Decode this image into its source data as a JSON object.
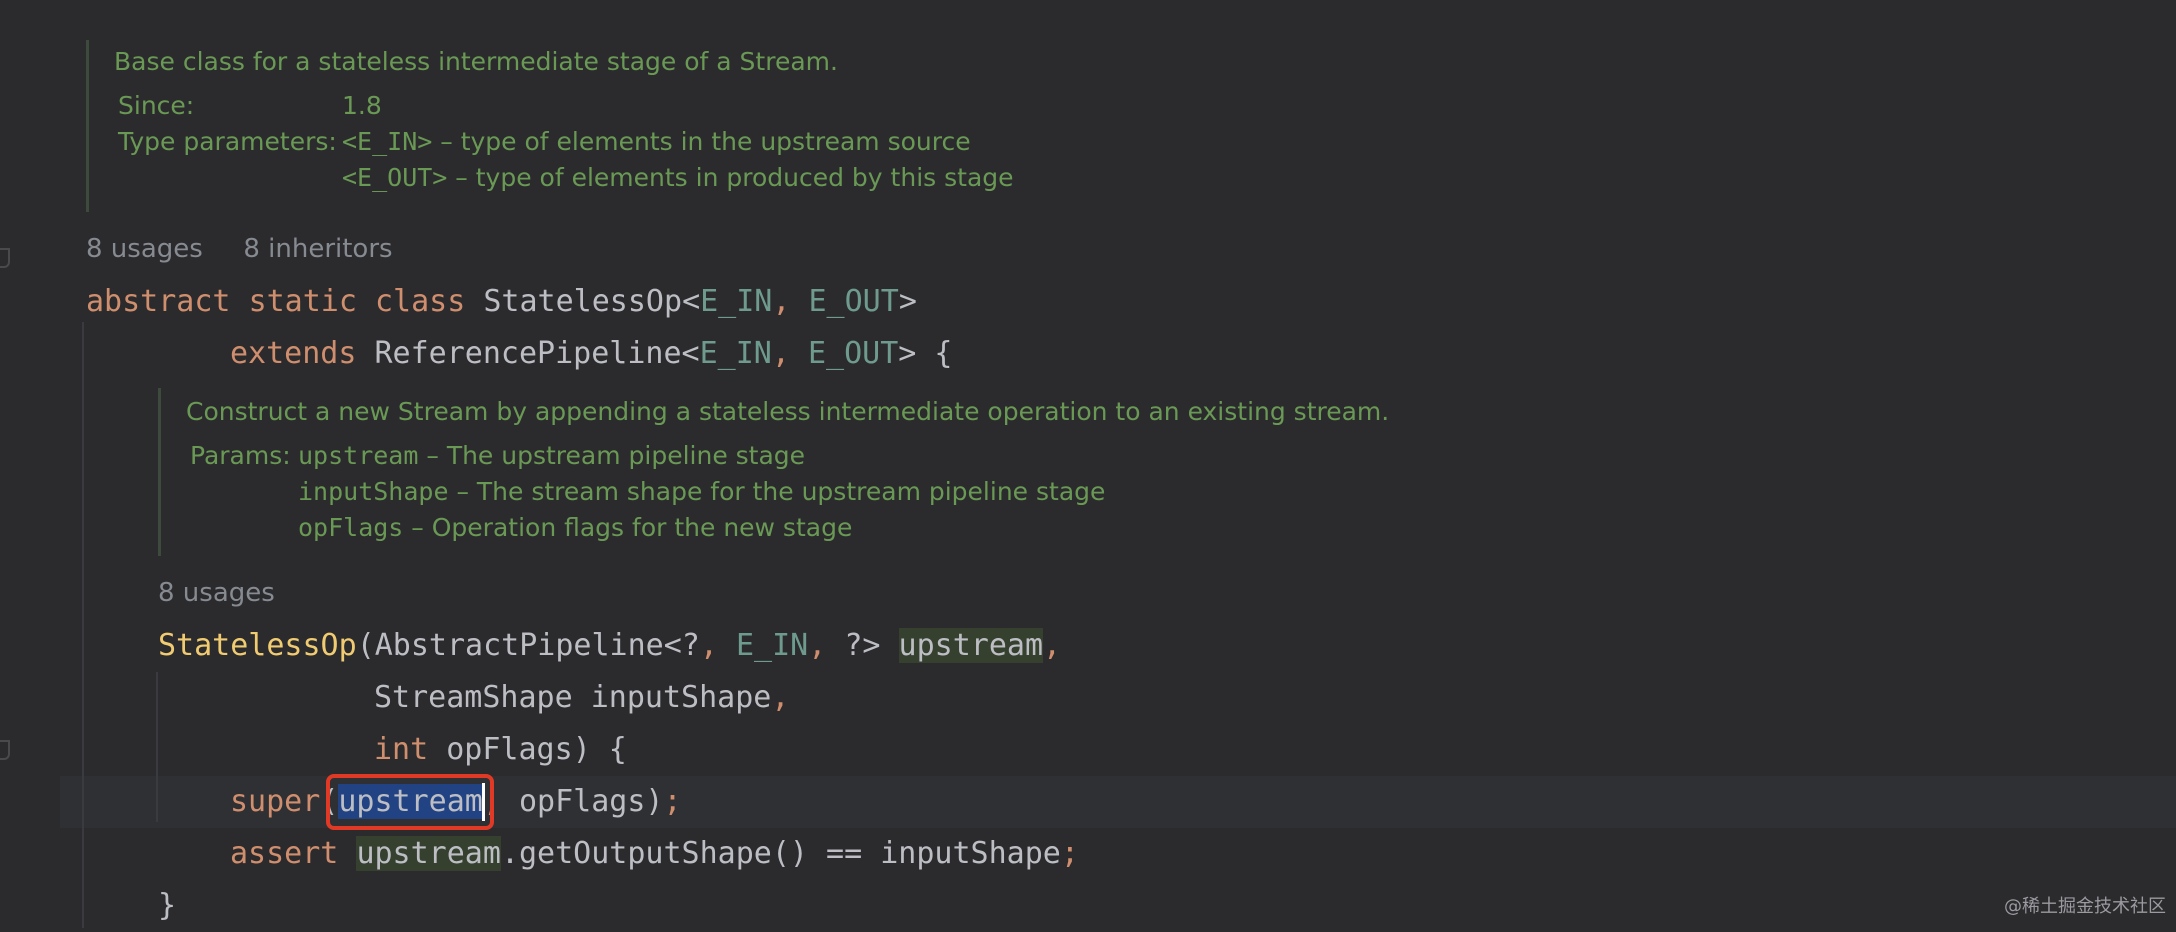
{
  "doc1": {
    "summary": "Base class for a stateless intermediate stage of a Stream.",
    "since_label": "Since:",
    "since_value": "1.8",
    "type_params_label": "Type parameters:",
    "tp1_name": "<E_IN>",
    "tp1_desc": " – type of elements in the upstream source",
    "tp2_name": "<E_OUT>",
    "tp2_desc": " – type of elements in produced by this stage"
  },
  "hint1": {
    "usages": "8 usages",
    "inheritors": "8 inheritors"
  },
  "class_decl": {
    "kw_abstract": "abstract",
    "kw_static": "static",
    "kw_class": "class",
    "name": "StatelessOp",
    "generic_open": "<",
    "t_in": "E_IN",
    "comma": ", ",
    "t_out": "E_OUT",
    "generic_close": ">",
    "kw_extends": "extends",
    "super_name": "ReferencePipeline",
    "brace_open": " {"
  },
  "doc2": {
    "summary": "Construct a new Stream by appending a stateless intermediate operation to an existing stream.",
    "params_label": "Params:",
    "p1_name": "upstream",
    "p1_desc": " – The upstream pipeline stage",
    "p2_name": "inputShape",
    "p2_desc": " – The stream shape for the upstream pipeline stage",
    "p3_name": "opFlags",
    "p3_desc": " – Operation flags for the new stage"
  },
  "hint2": {
    "usages": "8 usages"
  },
  "ctor": {
    "name": "StatelessOp",
    "paren_open": "(",
    "p1_type": "AbstractPipeline<?",
    "p1_t": "E_IN",
    "p1_tail": "?>",
    "p1_name": "upstream",
    "p2_type": "StreamShape",
    "p2_name": "inputShape",
    "p3_type": "int",
    "p3_name": "opFlags",
    "close": ") {"
  },
  "body": {
    "kw_super": "super",
    "paren_open": "(",
    "arg1": "upstream",
    "arg_rest": " opFlags)",
    "semi": ";",
    "kw_assert": "assert",
    "assert_var": "upstream",
    "assert_rest": ".getOutputShape() == inputShape",
    "closing_brace": "}"
  },
  "watermark": "@稀土掘金技术社区",
  "colors": {
    "background": "#2b2b2d",
    "keyword": "#cf8e6d",
    "function": "#f0cb72",
    "type_param": "#6f9b8e",
    "doc_comment": "#6a9955",
    "selection": "#214283",
    "highlight_box": "#e03a26"
  }
}
